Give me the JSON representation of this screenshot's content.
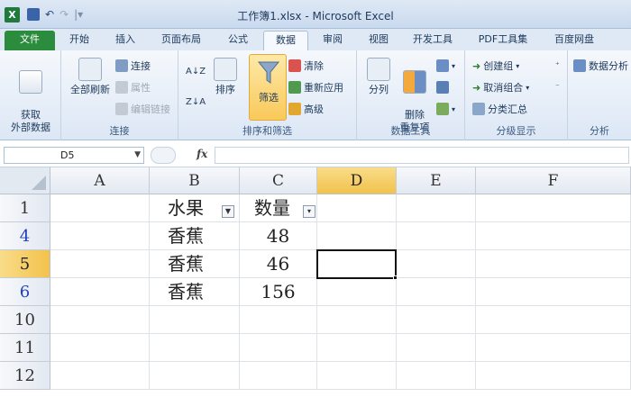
{
  "window": {
    "title": "工作簿1.xlsx - Microsoft Excel"
  },
  "qat": {
    "undo": "↶",
    "redo": "↷",
    "customize": "|▾"
  },
  "tabs": [
    {
      "label": "文件"
    },
    {
      "label": "开始"
    },
    {
      "label": "插入"
    },
    {
      "label": "页面布局"
    },
    {
      "label": "公式"
    },
    {
      "label": "数据"
    },
    {
      "label": "审阅"
    },
    {
      "label": "视图"
    },
    {
      "label": "开发工具"
    },
    {
      "label": "PDF工具集"
    },
    {
      "label": "百度网盘"
    }
  ],
  "ribbon": {
    "get_external_data": "获取\n外部数据",
    "refresh_all": "全部刷新",
    "connections": "连接",
    "properties": "属性",
    "edit_links": "编辑链接",
    "group_connections": "连接",
    "sort_asc": "A↓Z",
    "sort_desc": "Z↓A",
    "sort": "排序",
    "filter": "筛选",
    "clear": "清除",
    "reapply": "重新应用",
    "advanced": "高级",
    "group_sort_filter": "排序和筛选",
    "text_to_columns": "分列",
    "remove_duplicates": "删除\n重复项",
    "group_data_tools": "数据工具",
    "group": "创建组",
    "ungroup": "取消组合",
    "subtotal": "分类汇总",
    "group_outline": "分级显示",
    "data_analysis": "数据分析",
    "group_analysis": "分析"
  },
  "formula_bar": {
    "name_box": "D5",
    "fx": "fx",
    "value": ""
  },
  "grid": {
    "columns": [
      "A",
      "B",
      "C",
      "D",
      "E",
      "F"
    ],
    "selected_column": "D",
    "rows": [
      {
        "num": "1",
        "cells": {
          "B": "水果",
          "C": "数量"
        },
        "header": true
      },
      {
        "num": "4",
        "cells": {
          "B": "香蕉",
          "C": "48"
        }
      },
      {
        "num": "5",
        "cells": {
          "B": "香蕉",
          "C": "46"
        }
      },
      {
        "num": "6",
        "cells": {
          "B": "香蕉",
          "C": "156"
        }
      },
      {
        "num": "10",
        "cells": {}
      },
      {
        "num": "11",
        "cells": {}
      },
      {
        "num": "12",
        "cells": {}
      }
    ],
    "selected_row": "5",
    "active_cell": "D5"
  }
}
